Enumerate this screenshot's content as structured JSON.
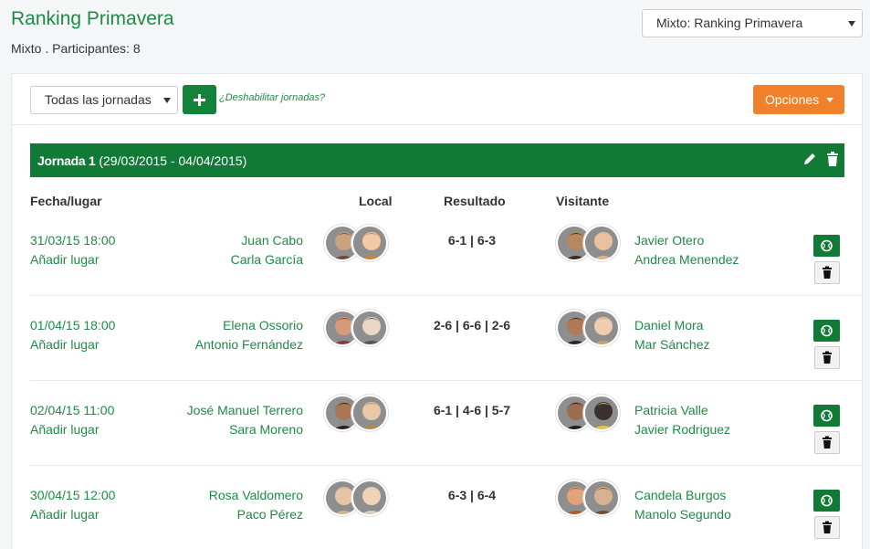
{
  "header": {
    "title": "Ranking Primavera",
    "subtitle": "Mixto . Participantes: 8",
    "ranking_select": "Mixto: Ranking Primavera"
  },
  "toolbar": {
    "rounds_select": "Todas las jornadas",
    "disable_link": "¿Deshabilitar jornadas?",
    "options_label": "Opciones"
  },
  "round": {
    "title": "Jornada 1",
    "dates": "(29/03/2015 - 04/04/2015)"
  },
  "columns": {
    "date_place": "Fecha/lugar",
    "home": "Local",
    "result": "Resultado",
    "away": "Visitante"
  },
  "matches": [
    {
      "date": "31/03/15 18:00",
      "place": "Añadir lugar",
      "home1": "Juan Cabo",
      "home2": "Carla García",
      "score": "6-1 | 6-3",
      "away1": "Javier Otero",
      "away2": "Andrea Menendez"
    },
    {
      "date": "01/04/15 18:00",
      "place": "Añadir lugar",
      "home1": "Elena Ossorio",
      "home2": "Antonio Fernández",
      "score": "2-6 | 6-6 | 2-6",
      "away1": "Daniel Mora",
      "away2": "Mar Sánchez"
    },
    {
      "date": "02/04/15 11:00",
      "place": "Añadir lugar",
      "home1": "José Manuel Terrero",
      "home2": "Sara Moreno",
      "score": "6-1 | 4-6 | 5-7",
      "away1": "Patricia Valle",
      "away2": "Javier Rodriguez"
    },
    {
      "date": "30/04/15 12:00",
      "place": "Añadir lugar",
      "home1": "Rosa Valdomero",
      "home2": "Paco Pérez",
      "score": "6-3 | 6-4",
      "away1": "Candela Burgos",
      "away2": "Manolo Segundo"
    }
  ],
  "colors": {
    "green": "#117a35",
    "link_green": "#1f8a45",
    "orange": "#f0812a"
  },
  "icons": [
    "plus-icon",
    "pencil-icon",
    "trash-icon",
    "tennis-ball-icon",
    "chevron-down-icon"
  ]
}
